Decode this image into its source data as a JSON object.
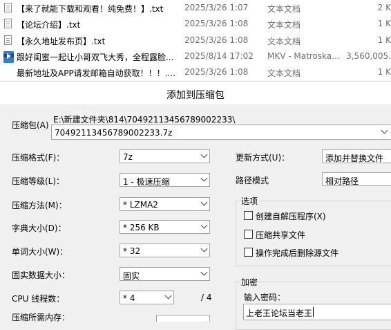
{
  "files": [
    {
      "name": "【来了就能下载和观看！纯免费！】.txt",
      "date": "2025/3/26 1:07",
      "type": "文本文档",
      "size": "2 K",
      "icon": "txt-file-icon"
    },
    {
      "name": "【论坛介绍】.txt",
      "date": "2025/3/26 1:08",
      "type": "文本文档",
      "size": "1 K",
      "icon": "txt-file-icon"
    },
    {
      "name": "【永久地址发布页】.txt",
      "date": "2025/3/26 1:08",
      "type": "文本文档",
      "size": "1 K",
      "icon": "txt-file-icon"
    },
    {
      "name": "跟好闺蜜一起让小哥双飞大秀，全程露脸...",
      "date": "2025/8/14 17:02",
      "type": "MKV - Matroska...",
      "size": "3,560,005.",
      "icon": "mkv-video-icon"
    },
    {
      "name": "最新地址及APP请发邮箱自动获取！！！....",
      "date": "2025/3/26 1:08",
      "type": "文本文档",
      "size": "1 K",
      "icon": "txt-file-icon"
    }
  ],
  "dialog": {
    "title": "添加到压缩包",
    "archive_label": "压缩包(A)",
    "archive_path": "E:\\新建文件夹\\814\\70492113456789002233\\",
    "archive_name": "70492113456789002233.7z",
    "format_label": "压缩格式(F)：",
    "format_value": "7z",
    "level_label": "压缩等级(L)：",
    "level_value": "1 - 极速压缩",
    "method_label": "压缩方法(M)：",
    "method_value": "* LZMA2",
    "dict_label": "字典大小(D)：",
    "dict_value": "* 256 KB",
    "word_label": "单词大小(W)：",
    "word_value": "* 32",
    "solid_label": "固实数据大小：",
    "solid_value": "固实",
    "threads_label": "CPU 线程数：",
    "threads_value": "* 4",
    "threads_total": "/ 4",
    "memory_label": "压缩所需内存：",
    "update_label": "更新方式(U)：",
    "update_value": "添加并替换文件",
    "path_mode_label": "路径模式",
    "path_mode_value": "相对路径",
    "options_legend": "选项",
    "option_sfx": "创建自解压程序(X)",
    "option_shared": "压缩共享文件",
    "option_delete": "操作完成后删除源文件",
    "encrypt_legend": "加密",
    "password_label": "输入密码：",
    "password_value": "上老王论坛当老王"
  }
}
